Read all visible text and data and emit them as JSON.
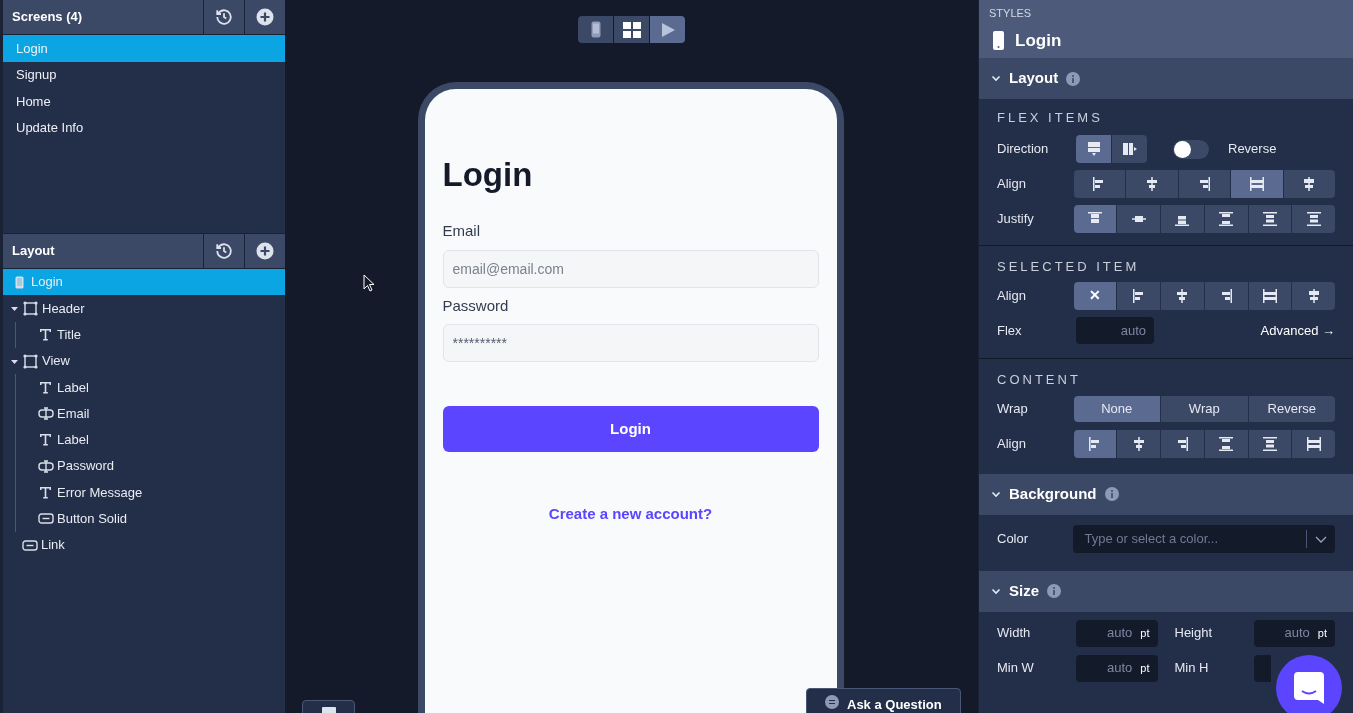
{
  "screens": {
    "title": "Screens (4)",
    "items": [
      {
        "label": "Login",
        "selected": true
      },
      {
        "label": "Signup",
        "selected": false
      },
      {
        "label": "Home",
        "selected": false
      },
      {
        "label": "Update Info",
        "selected": false
      }
    ]
  },
  "layout_tree": {
    "title": "Layout",
    "items": [
      {
        "label": "Login",
        "kind": "screen",
        "selected": true,
        "children": [
          {
            "label": "Header",
            "kind": "view",
            "selected": false,
            "expanded": true,
            "children": [
              {
                "label": "Title",
                "kind": "text",
                "selected": false
              }
            ]
          },
          {
            "label": "View",
            "kind": "view",
            "selected": false,
            "expanded": true,
            "children": [
              {
                "label": "Label",
                "kind": "text",
                "selected": false
              },
              {
                "label": "Email",
                "kind": "input",
                "selected": false
              },
              {
                "label": "Label",
                "kind": "text",
                "selected": false
              },
              {
                "label": "Password",
                "kind": "input",
                "selected": false
              },
              {
                "label": "Error Message",
                "kind": "text",
                "selected": false
              },
              {
                "label": "Button Solid",
                "kind": "button",
                "selected": false
              }
            ]
          },
          {
            "label": "Link",
            "kind": "button",
            "selected": false
          }
        ]
      }
    ]
  },
  "canvas_toolbar": [
    {
      "kind": "phone",
      "selected": false
    },
    {
      "kind": "grid",
      "selected": false
    },
    {
      "kind": "play",
      "selected": true
    }
  ],
  "phone": {
    "title": "Login",
    "fields": [
      {
        "label": "Email",
        "placeholder": "email@email.com"
      },
      {
        "label": "Password",
        "value": "**********"
      }
    ],
    "button": "Login",
    "link": "Create a new account?"
  },
  "ask_button": "Ask a Question",
  "styles": {
    "header": "STYLES",
    "title": "Login",
    "layout": {
      "title": "Layout",
      "flex_items": {
        "title": "FLEX ITEMS",
        "direction": {
          "label": "Direction",
          "options": [
            {
              "kind": "column",
              "selected": true
            },
            {
              "kind": "row",
              "selected": false
            }
          ],
          "reverse": {
            "label": "Reverse",
            "on": false
          }
        },
        "align": {
          "label": "Align",
          "options": [
            {
              "kind": "start",
              "selected": false
            },
            {
              "kind": "center",
              "selected": false
            },
            {
              "kind": "end",
              "selected": false
            },
            {
              "kind": "stretch",
              "selected": true
            },
            {
              "kind": "baseline",
              "selected": false
            }
          ]
        },
        "justify": {
          "label": "Justify",
          "options": [
            {
              "kind": "top",
              "selected": true
            },
            {
              "kind": "middle",
              "selected": false
            },
            {
              "kind": "bottom",
              "selected": false
            },
            {
              "kind": "between",
              "selected": false
            },
            {
              "kind": "around",
              "selected": false
            },
            {
              "kind": "evenly",
              "selected": false
            }
          ]
        }
      },
      "selected_item": {
        "title": "SELECTED ITEM",
        "align": {
          "label": "Align",
          "options": [
            {
              "kind": "none",
              "text": "✕",
              "selected": true
            },
            {
              "kind": "start",
              "selected": false
            },
            {
              "kind": "center",
              "selected": false
            },
            {
              "kind": "end",
              "selected": false
            },
            {
              "kind": "stretch",
              "selected": false
            },
            {
              "kind": "baseline",
              "selected": false
            }
          ]
        },
        "flex": {
          "label": "Flex",
          "placeholder": "auto"
        },
        "advanced": "Advanced →"
      },
      "content": {
        "title": "CONTENT",
        "wrap": {
          "label": "Wrap",
          "options": [
            {
              "label": "None",
              "selected": true
            },
            {
              "label": "Wrap",
              "selected": false
            },
            {
              "label": "Reverse",
              "selected": false
            }
          ]
        },
        "align": {
          "label": "Align",
          "options": [
            {
              "kind": "start",
              "selected": true
            },
            {
              "kind": "center",
              "selected": false
            },
            {
              "kind": "end",
              "selected": false
            },
            {
              "kind": "between",
              "selected": false
            },
            {
              "kind": "around",
              "selected": false
            },
            {
              "kind": "stretch",
              "selected": false
            }
          ]
        }
      }
    },
    "background": {
      "title": "Background",
      "color": {
        "label": "Color",
        "placeholder": "Type or select a color..."
      }
    },
    "size": {
      "title": "Size",
      "fields": [
        {
          "label": "Width",
          "placeholder": "auto",
          "unit": "pt"
        },
        {
          "label": "Height",
          "placeholder": "auto",
          "unit": "pt"
        },
        {
          "label": "Min W",
          "placeholder": "auto",
          "unit": "pt"
        },
        {
          "label": "Min H"
        }
      ]
    }
  }
}
